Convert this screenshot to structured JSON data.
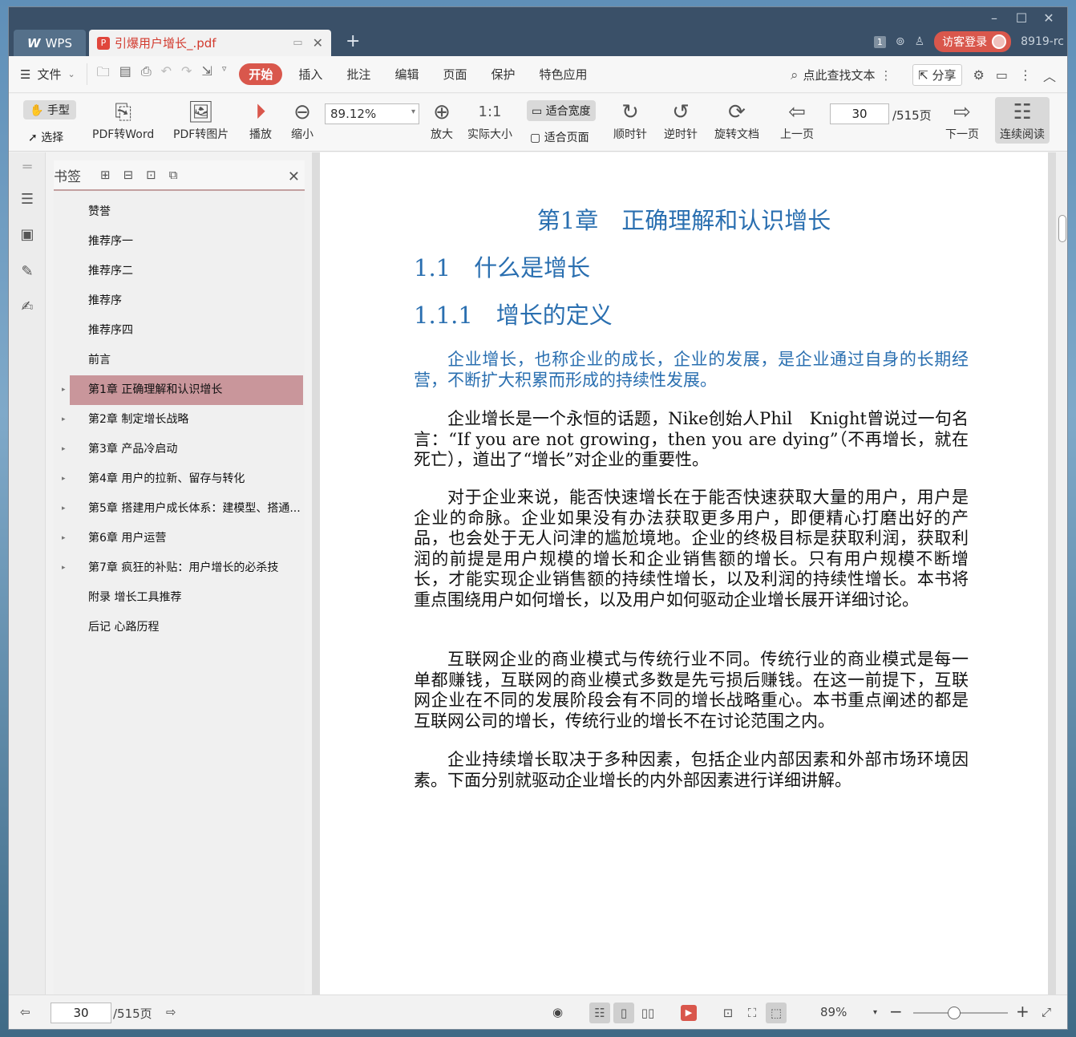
{
  "titlebar": {
    "wps_tab": "WPS",
    "doc_tab": "引爆用户增长_.pdf",
    "page_badge": "1",
    "login": "访客登录",
    "user_suffix": "8919-rc"
  },
  "menu": {
    "file": "文件",
    "start": "开始",
    "items": [
      "插入",
      "批注",
      "编辑",
      "页面",
      "保护",
      "特色应用"
    ],
    "search": "点此查找文本",
    "share": "分享"
  },
  "toolbar": {
    "hand": "手型",
    "select": "选择",
    "pdf_word": "PDF转Word",
    "pdf_img": "PDF转图片",
    "play": "播放",
    "zoom_out": "缩小",
    "zoom_value": "89.12%",
    "zoom_in": "放大",
    "actual": "实际大小",
    "fit_width": "适合宽度",
    "fit_page": "适合页面",
    "cw": "顺时针",
    "ccw": "逆时针",
    "rotate": "旋转文档",
    "prev": "上一页",
    "page": "30",
    "total": "/515页",
    "next": "下一页",
    "continuous": "连续阅读"
  },
  "bookmarks": {
    "title": "书签",
    "items": [
      {
        "label": "赞誉",
        "expandable": false,
        "active": false
      },
      {
        "label": "推荐序一",
        "expandable": false,
        "active": false
      },
      {
        "label": "推荐序二",
        "expandable": false,
        "active": false
      },
      {
        "label": "推荐序",
        "expandable": false,
        "active": false
      },
      {
        "label": "推荐序四",
        "expandable": false,
        "active": false
      },
      {
        "label": "前言",
        "expandable": false,
        "active": false
      },
      {
        "label": "第1章 正确理解和认识增长",
        "expandable": true,
        "active": true
      },
      {
        "label": "第2章 制定增长战略",
        "expandable": true,
        "active": false
      },
      {
        "label": "第3章 产品冷启动",
        "expandable": true,
        "active": false
      },
      {
        "label": "第4章 用户的拉新、留存与转化",
        "expandable": true,
        "active": false
      },
      {
        "label": "第5章 搭建用户成长体系：建模型、搭通...",
        "expandable": true,
        "active": false
      },
      {
        "label": "第6章 用户运营",
        "expandable": true,
        "active": false
      },
      {
        "label": "第7章 疯狂的补贴：用户增长的必杀技",
        "expandable": true,
        "active": false
      },
      {
        "label": "附录 增长工具推荐",
        "expandable": false,
        "active": false
      },
      {
        "label": "后记 心路历程",
        "expandable": false,
        "active": false
      }
    ]
  },
  "document": {
    "chapter": "第1章　正确理解和认识增长",
    "h_11": "1.1　什么是增长",
    "h_111": "1.1.1　增长的定义",
    "p_def": "企业增长，也称企业的成长，企业的发展，是企业通过自身的长期经营，不断扩大积累而形成的持续性发展。",
    "p1": "企业增长是一个永恒的话题，Nike创始人Phil　Knight曾说过一句名言：“If you are not growing，then you are dying”（不再增长，就在死亡），道出了“增长”对企业的重要性。",
    "p2": "对于企业来说，能否快速增长在于能否快速获取大量的用户，用户是企业的命脉。企业如果没有办法获取更多用户，即便精心打磨出好的产品，也会处于无人问津的尴尬境地。企业的终极目标是获取利润，获取利润的前提是用户规模的增长和企业销售额的增长。只有用户规模不断增长，才能实现企业销售额的持续性增长，以及利润的持续性增长。本书将重点围绕用户如何增长，以及用户如何驱动企业增长展开详细讨论。",
    "p3": "互联网企业的商业模式与传统行业不同。传统行业的商业模式是每一单都赚钱，互联网的商业模式多数是先亏损后赚钱。在这一前提下，互联网企业在不同的发展阶段会有不同的增长战略重心。本书重点阐述的都是互联网公司的增长，传统行业的增长不在讨论范围之内。",
    "p4": "企业持续增长取决于多种因素，包括企业内部因素和外部市场环境因素。下面分别就驱动企业增长的内外部因素进行详细讲解。"
  },
  "status": {
    "page": "30",
    "total": "/515页",
    "zoom": "89%"
  },
  "colors": {
    "accent": "#d9574c",
    "heading_blue": "#2a6fb0",
    "active_bookmark": "#c9969b"
  }
}
